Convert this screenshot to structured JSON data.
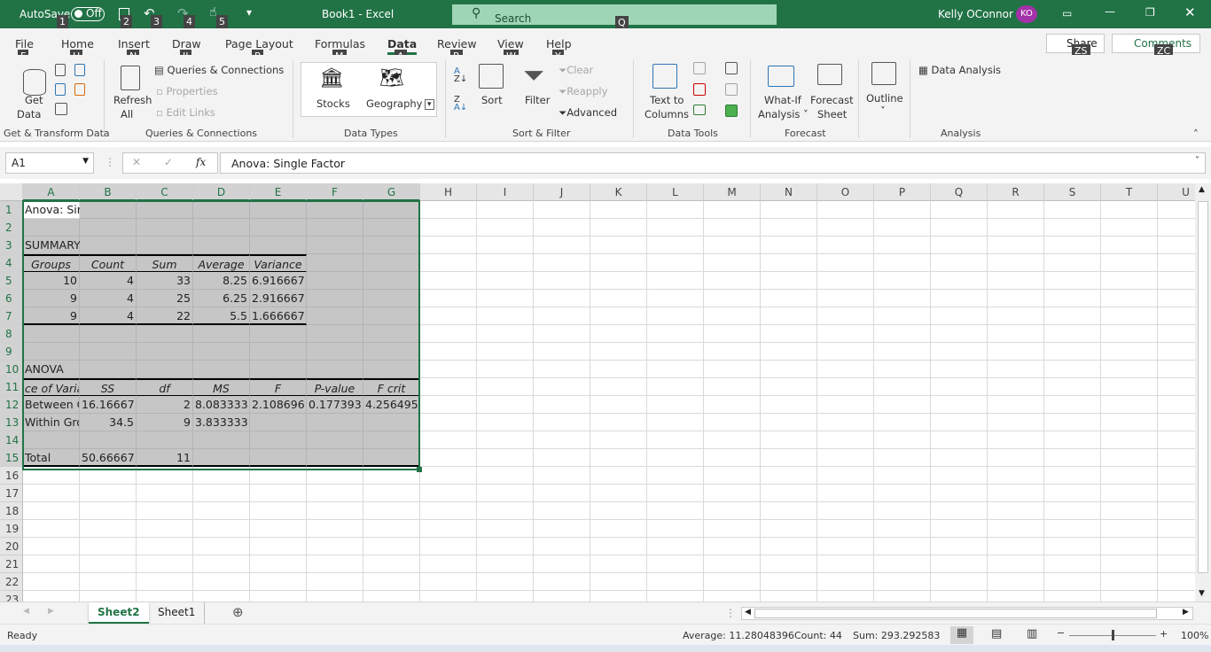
{
  "titlebar": {
    "autosave": "AutoSave",
    "toggle": "Off",
    "title": "Book1  -  Excel",
    "search": "Search",
    "user": "Kelly OConnor",
    "initials": "KO",
    "keytips": [
      "1",
      "2",
      "3",
      "4",
      "5",
      "Q"
    ],
    "brand_color": "#217346"
  },
  "tabs": [
    {
      "label": "File",
      "key": "F"
    },
    {
      "label": "Home",
      "key": "H"
    },
    {
      "label": "Insert",
      "key": "N"
    },
    {
      "label": "Draw",
      "key": "JI"
    },
    {
      "label": "Page Layout",
      "key": "P"
    },
    {
      "label": "Formulas",
      "key": "M"
    },
    {
      "label": "Data",
      "key": "A",
      "active": true
    },
    {
      "label": "Review",
      "key": "R"
    },
    {
      "label": "View",
      "key": "W"
    },
    {
      "label": "Help",
      "key": "Y"
    }
  ],
  "share": {
    "label": "Share",
    "key": "ZS"
  },
  "comments": {
    "label": "Comments",
    "key": "ZC"
  },
  "ribbon": {
    "get_data": "Get",
    "get_data2": "Data",
    "refresh": "Refresh",
    "refresh2": "All",
    "queries": "Queries & Connections",
    "properties": "Properties",
    "edit_links": "Edit Links",
    "stocks": "Stocks",
    "geography": "Geography",
    "sort": "Sort",
    "filter": "Filter",
    "clear": "Clear",
    "reapply": "Reapply",
    "advanced": "Advanced",
    "text_to": "Text to",
    "columns": "Columns",
    "whatif": "What-If",
    "analysis": "Analysis",
    "forecast": "Forecast",
    "sheet": "Sheet",
    "outline": "Outline",
    "data_analysis": "Data Analysis",
    "groups": [
      "Get & Transform Data",
      "Queries & Connections",
      "Data Types",
      "Sort & Filter",
      "Data Tools",
      "Forecast",
      "Analysis"
    ]
  },
  "formula_bar": {
    "name_box": "A1",
    "fx": "fx",
    "formula": "Anova: Single Factor"
  },
  "columns": [
    "A",
    "B",
    "C",
    "D",
    "E",
    "F",
    "G",
    "H",
    "I",
    "J",
    "K",
    "L",
    "M",
    "N",
    "O",
    "P",
    "Q",
    "R",
    "S",
    "T",
    "U"
  ],
  "rows": [
    "1",
    "2",
    "3",
    "4",
    "5",
    "6",
    "7",
    "8",
    "9",
    "10",
    "11",
    "12",
    "13",
    "14",
    "15",
    "16",
    "17",
    "18",
    "19",
    "20",
    "21",
    "22",
    "23"
  ],
  "cells": [
    [
      "Anova: Single Factor",
      "",
      "",
      "",
      "",
      "",
      ""
    ],
    [
      "",
      "",
      "",
      "",
      "",
      "",
      ""
    ],
    [
      "SUMMARY",
      "",
      "",
      "",
      "",
      "",
      ""
    ],
    [
      "Groups",
      "Count",
      "Sum",
      "Average",
      "Variance",
      "",
      ""
    ],
    [
      "10",
      "4",
      "33",
      "8.25",
      "6.916667",
      "",
      ""
    ],
    [
      "9",
      "4",
      "25",
      "6.25",
      "2.916667",
      "",
      ""
    ],
    [
      "9",
      "4",
      "22",
      "5.5",
      "1.666667",
      "",
      ""
    ],
    [
      "",
      "",
      "",
      "",
      "",
      "",
      ""
    ],
    [
      "",
      "",
      "",
      "",
      "",
      "",
      ""
    ],
    [
      "ANOVA",
      "",
      "",
      "",
      "",
      "",
      ""
    ],
    [
      "ce of Varia",
      "SS",
      "df",
      "MS",
      "F",
      "P-value",
      "F crit"
    ],
    [
      "Between G",
      "16.16667",
      "2",
      "8.083333",
      "2.108696",
      "0.177393",
      "4.256495"
    ],
    [
      "Within Gro",
      "34.5",
      "9",
      "3.833333",
      "",
      "",
      ""
    ],
    [
      "",
      "",
      "",
      "",
      "",
      "",
      ""
    ],
    [
      "Total",
      "50.66667",
      "11",
      "",
      "",
      "",
      ""
    ]
  ],
  "sheets": [
    {
      "name": "Sheet2",
      "active": true
    },
    {
      "name": "Sheet1"
    }
  ],
  "status": {
    "ready": "Ready",
    "average": "Average: 11.28048396",
    "count": "Count: 44",
    "sum": "Sum: 293.292583",
    "zoom": "100%",
    "zoom_level": 100
  }
}
